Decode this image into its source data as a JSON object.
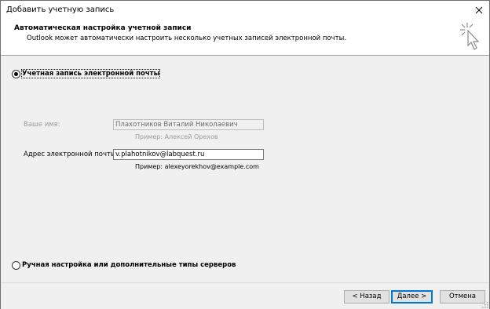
{
  "window": {
    "title": "Добавить учетную запись"
  },
  "header": {
    "title": "Автоматическая настройка учетной записи",
    "subtitle": "Outlook может автоматически настроить несколько учетных записей электронной почты."
  },
  "options": {
    "email_account_label": "Учетная запись электронной почты",
    "manual_setup_label": "Ручная настройка или дополнительные типы серверов"
  },
  "form": {
    "name_label": "Ваше имя:",
    "name_value": "Плахотников Виталий Николаевич",
    "name_example": "Пример: Алексей Орехов",
    "email_label": "Адрес электронной почты:",
    "email_value": "v.plahotnikov@labquest.ru",
    "email_example": "Пример: alexeyorekhov@example.com"
  },
  "buttons": {
    "back": "< Назад",
    "next": "Далее >",
    "cancel": "Отмена"
  },
  "colors": {
    "accent": "#0078d7",
    "content_bg": "#f0f0f0",
    "disabled_text": "#9a9a9a"
  }
}
